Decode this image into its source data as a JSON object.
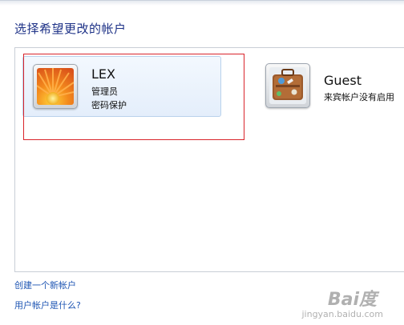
{
  "page": {
    "title": "选择希望更改的帐户"
  },
  "accounts": [
    {
      "name": "LEX",
      "role": "管理员",
      "status": "密码保护",
      "avatar": "orange-flower-avatar",
      "selected": true
    },
    {
      "name": "Guest",
      "role": "",
      "status": "来宾帐户没有启用",
      "avatar": "suitcase-avatar",
      "selected": false
    }
  ],
  "links": {
    "create_account": "创建一个新帐户",
    "what_is_account": "用户帐户是什么?"
  },
  "watermark": {
    "main": "Bai度",
    "sub": "jingyan.baidu.com"
  },
  "colors": {
    "title": "#1e3287",
    "link": "#1e55b3",
    "highlight": "#d9242b",
    "selected_tile": "#e4eefb"
  }
}
